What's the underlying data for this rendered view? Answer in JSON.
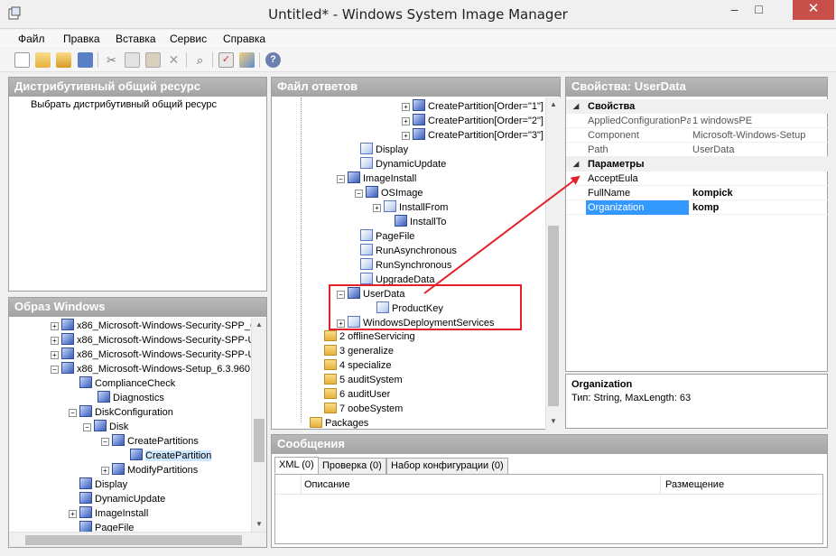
{
  "window": {
    "title": "Untitled* - Windows System Image Manager",
    "minimize": "–",
    "maximize": "□",
    "close": "✕"
  },
  "menu": [
    "Файл",
    "Правка",
    "Вставка",
    "Сервис",
    "Справка"
  ],
  "distribution_pane": {
    "header": "Дистрибутивный общий ресурс",
    "item": "Выбрать дистрибутивный общий ресурс"
  },
  "image_pane": {
    "header": "Образ Windows",
    "items": [
      {
        "label": "x86_Microsoft-Windows-Security-SPP_6",
        "pm": "+"
      },
      {
        "label": "x86_Microsoft-Windows-Security-SPP-U",
        "pm": "+"
      },
      {
        "label": "x86_Microsoft-Windows-Security-SPP-U",
        "pm": "+"
      },
      {
        "label": "x86_Microsoft-Windows-Setup_6.3.960",
        "pm": "−"
      },
      {
        "label": "ComplianceCheck",
        "pm": ""
      },
      {
        "label": "Diagnostics",
        "pm": ""
      },
      {
        "label": "DiskConfiguration",
        "pm": "−"
      },
      {
        "label": "Disk",
        "pm": "−"
      },
      {
        "label": "CreatePartitions",
        "pm": "−"
      },
      {
        "label": "CreatePartition",
        "pm": ""
      },
      {
        "label": "ModifyPartitions",
        "pm": "+"
      },
      {
        "label": "Display",
        "pm": ""
      },
      {
        "label": "DynamicUpdate",
        "pm": ""
      },
      {
        "label": "ImageInstall",
        "pm": "+"
      },
      {
        "label": "PageFile",
        "pm": ""
      }
    ]
  },
  "answer_pane": {
    "header": "Файл ответов",
    "items": [
      {
        "label": "CreatePartition[Order=\"1\"]",
        "pm": "+"
      },
      {
        "label": "CreatePartition[Order=\"2\"]",
        "pm": "+"
      },
      {
        "label": "CreatePartition[Order=\"3\"]",
        "pm": "+"
      },
      {
        "label": "Display",
        "pm": ""
      },
      {
        "label": "DynamicUpdate",
        "pm": ""
      },
      {
        "label": "ImageInstall",
        "pm": "−"
      },
      {
        "label": "OSImage",
        "pm": "−"
      },
      {
        "label": "InstallFrom",
        "pm": "+"
      },
      {
        "label": "InstallTo",
        "pm": ""
      },
      {
        "label": "PageFile",
        "pm": ""
      },
      {
        "label": "RunAsynchronous",
        "pm": ""
      },
      {
        "label": "RunSynchronous",
        "pm": ""
      },
      {
        "label": "UpgradeData",
        "pm": ""
      },
      {
        "label": "UserData",
        "pm": "−"
      },
      {
        "label": "ProductKey",
        "pm": ""
      },
      {
        "label": "WindowsDeploymentServices",
        "pm": "+"
      },
      {
        "label": "2 offlineServicing",
        "pm": ""
      },
      {
        "label": "3 generalize",
        "pm": ""
      },
      {
        "label": "4 specialize",
        "pm": ""
      },
      {
        "label": "5 auditSystem",
        "pm": ""
      },
      {
        "label": "6 auditUser",
        "pm": ""
      },
      {
        "label": "7 oobeSystem",
        "pm": ""
      },
      {
        "label": "Packages",
        "pm": ""
      }
    ]
  },
  "properties_pane": {
    "header": "Свойства: UserData",
    "cat1": "Свойства",
    "rows1": [
      {
        "k": "AppliedConfigurationPa",
        "v": "1 windowsPE"
      },
      {
        "k": "Component",
        "v": "Microsoft-Windows-Setup"
      },
      {
        "k": "Path",
        "v": "UserData"
      }
    ],
    "cat2": "Параметры",
    "rows2": [
      {
        "k": "AcceptEula",
        "v": ""
      },
      {
        "k": "FullName",
        "v": "kompick"
      },
      {
        "k": "Organization",
        "v": "komp"
      }
    ],
    "desc_title": "Organization",
    "desc_text": "Тип: String, MaxLength: 63"
  },
  "messages_pane": {
    "header": "Сообщения",
    "tabs": [
      "XML (0)",
      "Проверка (0)",
      "Набор конфигурации (0)"
    ],
    "col_desc": "Описание",
    "col_loc": "Размещение"
  },
  "colors": {
    "highlight_box": "#e4202a",
    "selection": "#3399ff"
  }
}
